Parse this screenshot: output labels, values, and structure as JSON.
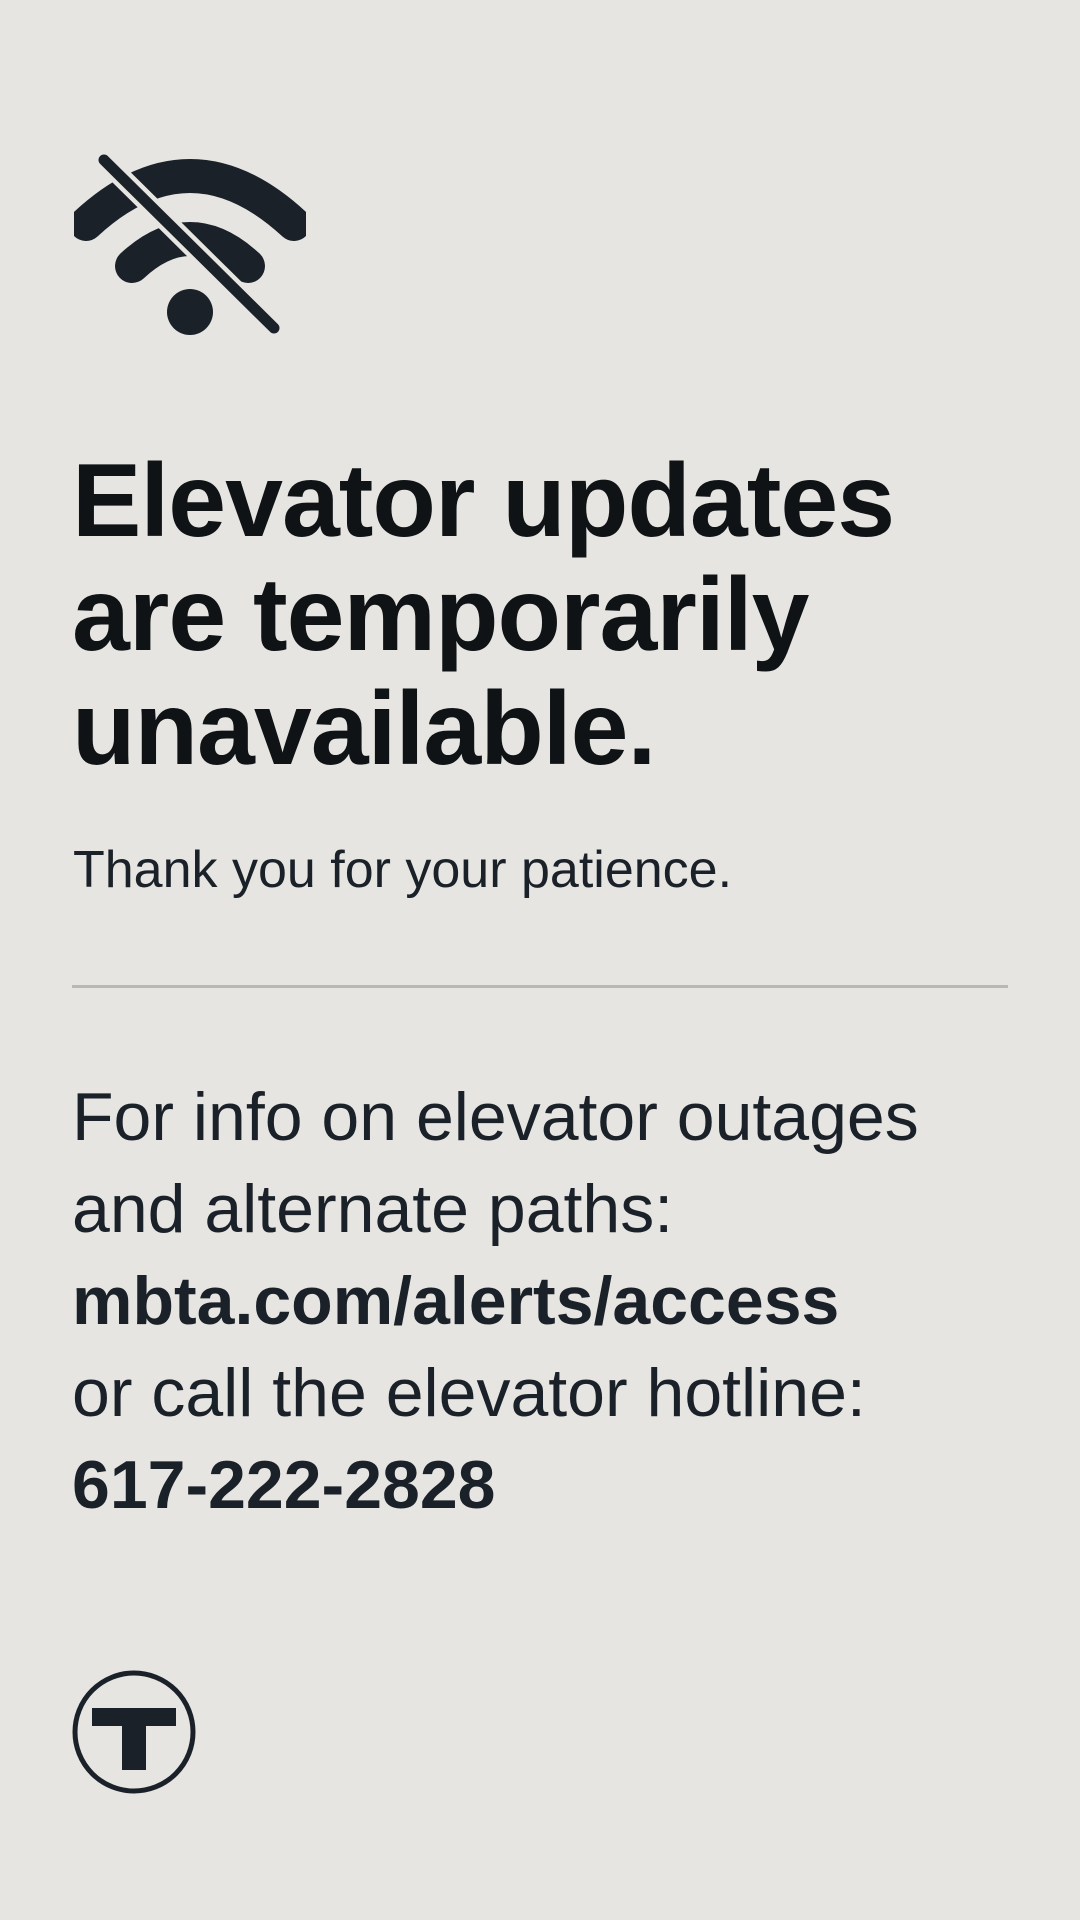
{
  "status_icon": "wifi-off-icon",
  "headline": "Elevator updates are temporarily unavailable.",
  "subtext": "Thank you for your patience.",
  "info": {
    "intro_line1": "For info on elevator outages",
    "intro_line2": "and alternate paths:",
    "url": "mbta.com/alerts/access",
    "hotline_prompt": "or call the elevator hotline:",
    "phone": "617-222-2828"
  },
  "logo_icon": "mbta-t-logo-icon",
  "colors": {
    "background": "#e6e5e2",
    "text": "#1b2128",
    "divider": "#b9b8b5"
  }
}
